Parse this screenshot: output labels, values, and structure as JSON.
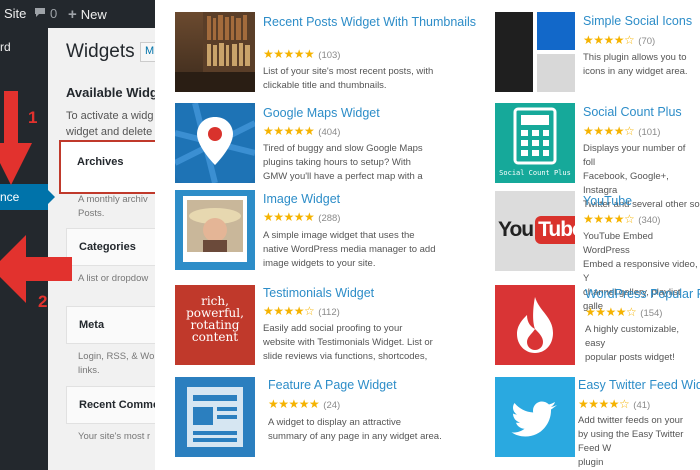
{
  "adminbar": {
    "site_label": "Site",
    "comments_count": "0",
    "new_label": "New"
  },
  "sidebar": {
    "partial_label": "rd",
    "active_label": "nce"
  },
  "widgets_page": {
    "title": "Widgets",
    "manage_label": "M",
    "available_title": "Available Widg",
    "available_desc_1": "To activate a widg",
    "available_desc_2": "widget and delete"
  },
  "widget_list": [
    {
      "name": "Archives",
      "desc": "A monthly archiv\nPosts."
    },
    {
      "name": "Categories",
      "desc": "A list or dropdow"
    },
    {
      "name": "Meta",
      "desc": "Login, RSS, & Wo\nlinks."
    },
    {
      "name": "Recent Comme",
      "desc": "Your site's most r"
    }
  ],
  "annotations": {
    "arrow1_number": "1",
    "arrow2_number": "2"
  },
  "plugins_left": [
    {
      "name": "Recent Posts Widget With\nThumbnails",
      "rating": 5,
      "count": "(103)",
      "desc": "List of your site's most recent posts, with\nclickable title and thumbnails."
    },
    {
      "name": "Google Maps Widget",
      "rating": 5,
      "count": "(404)",
      "desc": "Tired of buggy and slow Google Maps\nplugins taking hours to setup? With\nGMW you'll have a perfect map with a"
    },
    {
      "name": "Image Widget",
      "rating": 5,
      "count": "(288)",
      "desc": "A simple image widget that uses the\nnative WordPress media manager to add\nimage widgets to your site."
    },
    {
      "name": "Testimonials Widget",
      "rating": 4.5,
      "count": "(112)",
      "desc": "Easily add social proofing to your\nwebsite with Testimonials Widget. List or\nslide reviews via functions, shortcodes,"
    },
    {
      "name": "Feature A Page Widget",
      "rating": 5,
      "count": "(24)",
      "desc": "A widget to display an attractive\nsummary of any page in any widget area."
    }
  ],
  "plugins_right": [
    {
      "name": "Simple Social Icons",
      "rating": 4.5,
      "count": "(70)",
      "desc": "This plugin allows you to\nicons in any widget area."
    },
    {
      "name": "Social Count Plus",
      "rating": 4.5,
      "count": "(101)",
      "desc": "Displays your number of foll\nFacebook, Google+, Instagra\nTwitter and several other so"
    },
    {
      "name": "YouTube",
      "rating": 4.5,
      "count": "(340)",
      "desc": "YouTube Embed WordPress\nEmbed a responsive video, Y\nchannel gallery, playlist galle"
    },
    {
      "name": "WordPress Popular Po",
      "rating": 4.5,
      "count": "(154)",
      "desc": "A highly customizable, easy\npopular posts widget!"
    },
    {
      "name": "Easy Twitter Feed Widget",
      "rating": 4,
      "count": "(41)",
      "desc": "Add twitter feeds on your\nby using the Easy Twitter Feed W\nplugin"
    }
  ],
  "thumb_text": {
    "testimonials": "rich,\npowerful,\nrotating\ncontent",
    "social_count": "Social Count Plus",
    "youtube_you": "You",
    "youtube_tube": "Tube"
  },
  "colors": {
    "accent_blue": "#0073aa",
    "link_blue": "#2d8dc8",
    "star": "#f5b301",
    "annotation_red": "#e2322e",
    "admin_dark": "#23282d"
  }
}
